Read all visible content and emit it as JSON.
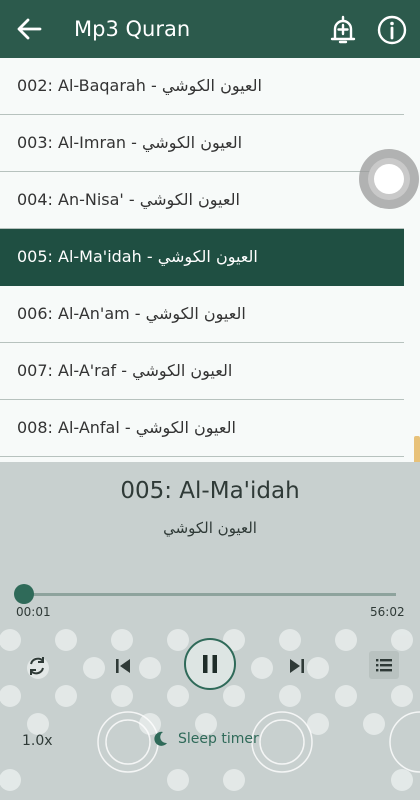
{
  "appbar": {
    "title": "Mp3 Quran"
  },
  "list": {
    "items": [
      {
        "label": "002: Al-Baqarah - العيون الكوشي",
        "selected": false
      },
      {
        "label": "003: Al-Imran - العيون الكوشي",
        "selected": false
      },
      {
        "label": "004: An-Nisa' - العيون الكوشي",
        "selected": false
      },
      {
        "label": "005: Al-Ma'idah - العيون الكوشي",
        "selected": true
      },
      {
        "label": "006: Al-An'am - العيون الكوشي",
        "selected": false
      },
      {
        "label": "007: Al-A'raf - العيون الكوشي",
        "selected": false
      },
      {
        "label": "008: Al-Anfal - العيون الكوشي",
        "selected": false
      }
    ]
  },
  "player": {
    "title": "005: Al-Ma'idah",
    "reciter": "العيون الكوشي",
    "current_time": "00:01",
    "total_time": "56:02",
    "progress": 0.0003,
    "speed": "1.0x",
    "sleep_timer_label": "Sleep timer"
  },
  "colors": {
    "primary": "#2c5a4c",
    "selected_row": "#1f4f42",
    "accent": "#2f6a59"
  },
  "icons": [
    "back-arrow-icon",
    "bell-plus-icon",
    "info-icon",
    "repeat-icon",
    "previous-icon",
    "pause-icon",
    "next-icon",
    "playlist-icon",
    "moon-icon"
  ]
}
